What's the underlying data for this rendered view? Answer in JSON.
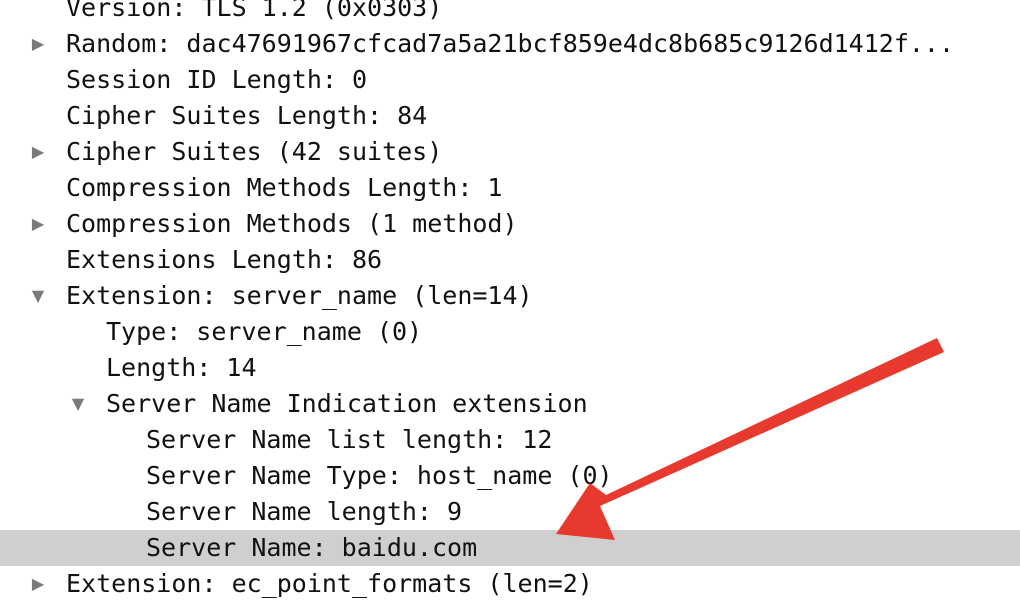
{
  "tree": {
    "rows": [
      {
        "label": "Version: TLS 1.2 (0x0303)",
        "toggle": ""
      },
      {
        "label": "Random: dac47691967cfcad7a5a21bcf859e4dc8b685c9126d1412f...",
        "toggle": "▶"
      },
      {
        "label": "Session ID Length: 0",
        "toggle": ""
      },
      {
        "label": "Cipher Suites Length: 84",
        "toggle": ""
      },
      {
        "label": "Cipher Suites (42 suites)",
        "toggle": "▶"
      },
      {
        "label": "Compression Methods Length: 1",
        "toggle": ""
      },
      {
        "label": "Compression Methods (1 method)",
        "toggle": "▶"
      },
      {
        "label": "Extensions Length: 86",
        "toggle": ""
      },
      {
        "label": "Extension: server_name (len=14)",
        "toggle": "▼"
      },
      {
        "label": "Type: server_name (0)",
        "toggle": ""
      },
      {
        "label": "Length: 14",
        "toggle": ""
      },
      {
        "label": "Server Name Indication extension",
        "toggle": "▼"
      },
      {
        "label": "Server Name list length: 12",
        "toggle": ""
      },
      {
        "label": "Server Name Type: host_name (0)",
        "toggle": ""
      },
      {
        "label": "Server Name length: 9",
        "toggle": ""
      },
      {
        "label": "Server Name: baidu.com",
        "toggle": ""
      },
      {
        "label": "Extension: ec_point_formats (len=2)",
        "toggle": "▶"
      }
    ]
  },
  "colors": {
    "selected_row": "#cfcfcf",
    "annotation_arrow": "#e8392f",
    "toggle": "#7a7a7a"
  }
}
